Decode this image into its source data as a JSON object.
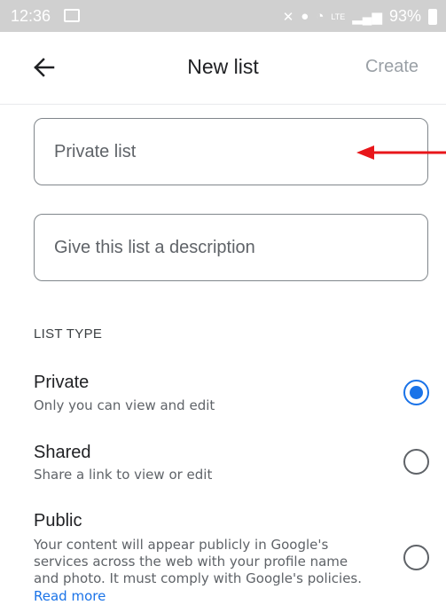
{
  "status_bar": {
    "time": "12:36",
    "icons": [
      "image-icon",
      "mute-icon",
      "location-icon",
      "wifi-icon",
      "lte-icon",
      "signal-icon"
    ],
    "lte": "LTE",
    "battery": "93%"
  },
  "app_bar": {
    "title": "New list",
    "create_label": "Create"
  },
  "fields": {
    "name_placeholder": "Private list",
    "description_placeholder": "Give this list a description"
  },
  "list_type": {
    "header": "LIST TYPE",
    "options": [
      {
        "title": "Private",
        "description": "Only you can view and edit",
        "selected": true
      },
      {
        "title": "Shared",
        "description": "Share a link to view or edit",
        "selected": false
      },
      {
        "title": "Public",
        "description_lines": [
          "Your content will appear publicly in Google's",
          "services across the web with your profile name",
          "and photo. It must comply with Google's policies."
        ],
        "link": "Read more",
        "selected": false
      }
    ]
  },
  "colors": {
    "accent": "#1a73e8",
    "annotation_arrow": "#e8161a"
  }
}
